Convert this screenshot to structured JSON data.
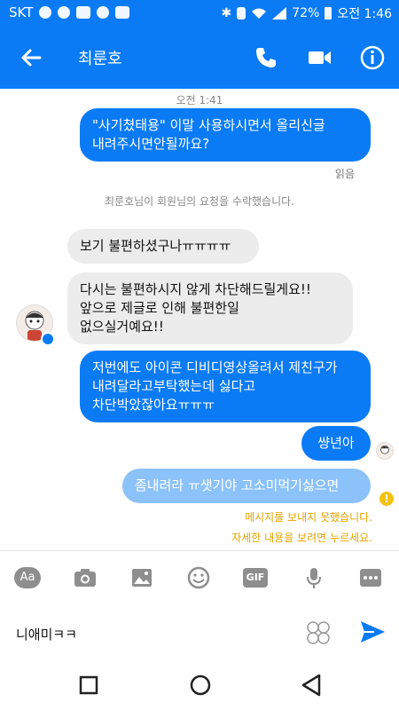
{
  "status_bar": {
    "carrier": "SKT",
    "battery": "72%",
    "time": "오전 1:46",
    "icons": [
      "cloud-icon",
      "messenger-icon",
      "image-icon",
      "talk-icon",
      "save-icon",
      "bluetooth-icon",
      "vibrate-icon",
      "wifi-icon",
      "signal-icon",
      "battery-icon"
    ]
  },
  "header": {
    "title": "최룬호",
    "back_icon": "back-arrow-icon",
    "call_icon": "phone-icon",
    "video_icon": "video-icon",
    "info_icon": "info-icon"
  },
  "chat": {
    "timestamp": "오전 1:41",
    "messages": [
      {
        "from": "me",
        "text": "\"사기쳤태용\" 이말 사용하시면서 올리신글\n내려주시면안될까요?"
      },
      {
        "from": "me_status",
        "text": "읽음"
      },
      {
        "from": "system",
        "text": "최룬호님이 회원님의 요청을 수락했습니다."
      },
      {
        "from": "them",
        "text": "보기 불편하셨구나ㅠㅠㅠㅠ"
      },
      {
        "from": "them",
        "text": "다시는 불편하시지 않게 차단해드릴게요!!\n앞으로 제글로 인해 불편한일\n없으실거예요!!"
      },
      {
        "from": "me",
        "text": "저번에도 아이콘 디비디영상올려서 제친구가\n내려달라고부탁했는데 싫다고\n차단박았잖아요ㅠㅠㅠ"
      },
      {
        "from": "me",
        "text": "썅년아"
      },
      {
        "from": "me_failed",
        "text": "좀내려라 ㅠ샛기야 고소미먹기싫으면"
      }
    ],
    "error_icon_text": "!",
    "error_line1": "메시지를 보내지 못했습니다.",
    "error_line2": "자세한 내용을 보려면 누르세요."
  },
  "toolbar": {
    "aa_label": "Aa",
    "gif_label": "GIF",
    "icons": [
      "camera-icon",
      "gallery-icon",
      "emoji-icon",
      "mic-icon",
      "more-icon"
    ]
  },
  "composer": {
    "value": "니애미ㅋㅋ",
    "sticker_icon": "sticker-icon",
    "send_icon": "send-icon"
  },
  "navigation": {
    "icons": [
      "recent-apps-icon",
      "home-icon",
      "back-icon"
    ]
  },
  "colors": {
    "accent": "#0a7bf5",
    "bubble_failed": "#8cc2fa",
    "bubble_in": "#ececec",
    "error": "#e5a400"
  }
}
